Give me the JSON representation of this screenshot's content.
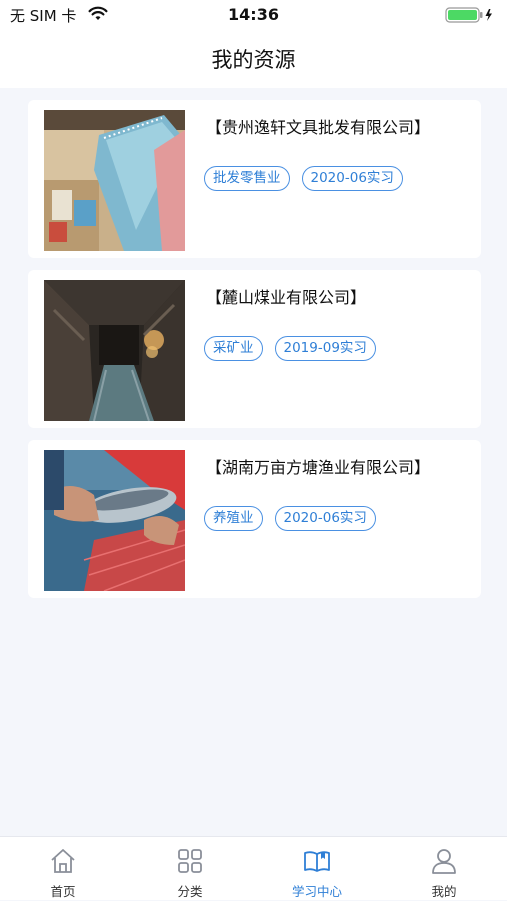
{
  "status": {
    "carrier": "无 SIM 卡",
    "time": "14:36"
  },
  "nav": {
    "title": "我的资源"
  },
  "resources": [
    {
      "title": "【贵州逸轩文具批发有限公司】",
      "tags": [
        "批发零售业",
        "2020-06实习"
      ],
      "thumb": "stationery-photo"
    },
    {
      "title": "【麓山煤业有限公司】",
      "tags": [
        "采矿业",
        "2019-09实习"
      ],
      "thumb": "coal-mine-photo"
    },
    {
      "title": "【湖南万亩方塘渔业有限公司】",
      "tags": [
        "养殖业",
        "2020-06实习"
      ],
      "thumb": "fishery-photo"
    }
  ],
  "tabs": [
    {
      "label": "首页",
      "icon": "home-icon",
      "active": false
    },
    {
      "label": "分类",
      "icon": "grid-icon",
      "active": false
    },
    {
      "label": "学习中心",
      "icon": "book-icon",
      "active": true
    },
    {
      "label": "我的",
      "icon": "user-icon",
      "active": false
    }
  ],
  "colors": {
    "accent": "#2f7fd6",
    "background": "#f4f6fb",
    "battery": "#4cd964"
  }
}
